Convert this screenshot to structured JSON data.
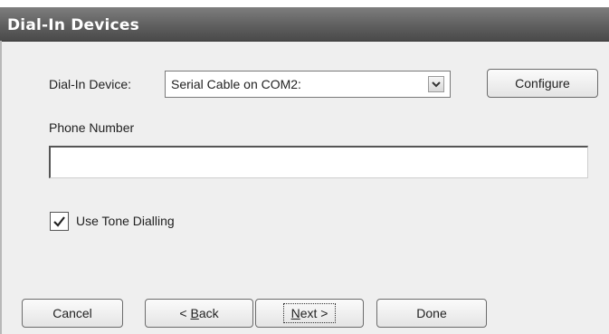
{
  "window": {
    "title": "Dial-In Devices"
  },
  "device": {
    "label": "Dial-In Device:",
    "selected": "Serial Cable on COM2:"
  },
  "phone": {
    "label": "Phone Number",
    "value": ""
  },
  "tone": {
    "label": "Use Tone Dialling",
    "checked": true
  },
  "buttons": {
    "configure": "Configure",
    "cancel": "Cancel",
    "back_prefix": "< ",
    "back_accel": "B",
    "back_rest": "ack",
    "next_accel": "N",
    "next_rest": "ext >",
    "done": "Done"
  },
  "icons": {
    "dropdown": "chevron-down-icon",
    "check": "check-icon"
  }
}
